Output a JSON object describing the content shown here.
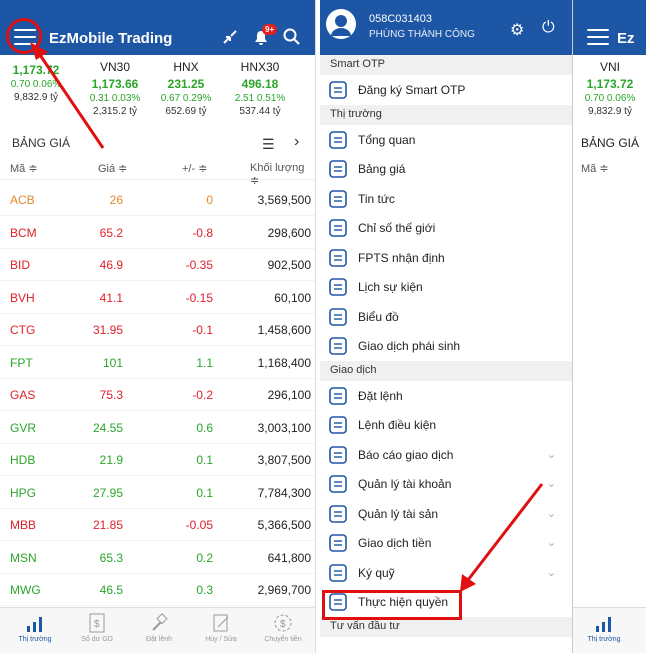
{
  "header": {
    "app_title": "EzMobile Trading",
    "notif_badge": "9+"
  },
  "indices": [
    {
      "name": "",
      "value": "1,173.72",
      "change": "0.70  0.06%",
      "volume": "9,832.9 tỷ"
    },
    {
      "name": "VN30",
      "value": "1,173.66",
      "change": "0.31  0.03%",
      "volume": "2,315.2 tỷ"
    },
    {
      "name": "HNX",
      "value": "231.25",
      "change": "0.67  0.29%",
      "volume": "652.69 tỷ"
    },
    {
      "name": "HNX30",
      "value": "496.18",
      "change": "2.51  0.51%",
      "volume": "537.44 tỷ"
    }
  ],
  "board": {
    "title": "BẢNG GIÁ",
    "col_code": "Mã ≑",
    "col_price": "Giá ≑",
    "col_change": "+/- ≑",
    "col_volume": "Khối lượng ≑"
  },
  "rows": [
    {
      "code": "ACB",
      "price": "26",
      "change": "0",
      "volume": "3,569,500"
    },
    {
      "code": "BCM",
      "price": "65.2",
      "change": "-0.8",
      "volume": "298,600"
    },
    {
      "code": "BID",
      "price": "46.9",
      "change": "-0.35",
      "volume": "902,500"
    },
    {
      "code": "BVH",
      "price": "41.1",
      "change": "-0.15",
      "volume": "60,100"
    },
    {
      "code": "CTG",
      "price": "31.95",
      "change": "-0.1",
      "volume": "1,458,600"
    },
    {
      "code": "FPT",
      "price": "101",
      "change": "1.1",
      "volume": "1,168,400"
    },
    {
      "code": "GAS",
      "price": "75.3",
      "change": "-0.2",
      "volume": "296,100"
    },
    {
      "code": "GVR",
      "price": "24.55",
      "change": "0.6",
      "volume": "3,003,100"
    },
    {
      "code": "HDB",
      "price": "21.9",
      "change": "0.1",
      "volume": "3,807,500"
    },
    {
      "code": "HPG",
      "price": "27.95",
      "change": "0.1",
      "volume": "7,784,300"
    },
    {
      "code": "MBB",
      "price": "21.85",
      "change": "-0.05",
      "volume": "5,366,500"
    },
    {
      "code": "MSN",
      "price": "65.3",
      "change": "0.2",
      "volume": "641,800"
    },
    {
      "code": "MWG",
      "price": "46.5",
      "change": "0.3",
      "volume": "2,969,700"
    }
  ],
  "tabs": [
    "Thị trường",
    "Số dư GD",
    "Đặt lệnh",
    "Hủy / Sửa",
    "Chuyển tiền"
  ],
  "menu": {
    "account": "058C031403",
    "user_name": "PHÙNG THÀNH CÔNG",
    "groups": [
      {
        "title": "Smart OTP",
        "items": [
          {
            "label": "Đăng ký Smart OTP",
            "icon": "phone-otp-icon"
          }
        ]
      },
      {
        "title": "Thị trường",
        "items": [
          {
            "label": "Tổng quan",
            "icon": "pie-chart-icon"
          },
          {
            "label": "Bảng giá",
            "icon": "price-board-icon"
          },
          {
            "label": "Tin tức",
            "icon": "news-icon"
          },
          {
            "label": "Chỉ số thế giới",
            "icon": "globe-icon"
          },
          {
            "label": "FPTS nhận định",
            "icon": "trend-chart-icon"
          },
          {
            "label": "Lịch sự kiện",
            "icon": "calendar-icon"
          },
          {
            "label": "Biểu đồ",
            "icon": "bar-chart-icon"
          },
          {
            "label": "Giao dịch phái sinh",
            "icon": "derivatives-icon"
          }
        ]
      },
      {
        "title": "Giao dịch",
        "items": [
          {
            "label": "Đặt lệnh",
            "icon": "gavel-icon"
          },
          {
            "label": "Lệnh điều kiện",
            "icon": "condition-order-icon"
          },
          {
            "label": "Báo cáo giao dịch",
            "icon": "report-icon",
            "expand": true
          },
          {
            "label": "Quản lý tài khoản",
            "icon": "account-icon",
            "expand": true
          },
          {
            "label": "Quản lý tài sản",
            "icon": "asset-icon",
            "expand": true
          },
          {
            "label": "Giao dịch tiền",
            "icon": "money-icon",
            "expand": true
          },
          {
            "label": "Ký quỹ",
            "icon": "margin-icon",
            "expand": true
          },
          {
            "label": "Thực hiện quyền",
            "icon": "rights-icon"
          }
        ]
      },
      {
        "title": "Tư vấn đầu tư",
        "items": []
      }
    ]
  },
  "partial": {
    "index_name": "VNI",
    "index_value": "1,173.72",
    "index_change": "0.70  0.06%",
    "index_volume": "9,832.9 tỷ",
    "board_title": "BẢNG GIÁ",
    "col_code": "Mã ≑",
    "tab_label": "Thị trường"
  },
  "colors": {
    "brand": "#1d56a5",
    "up": "#2aa52a",
    "down": "#e0202a",
    "ref": "#e08a2a",
    "annotation": "#e01010"
  }
}
